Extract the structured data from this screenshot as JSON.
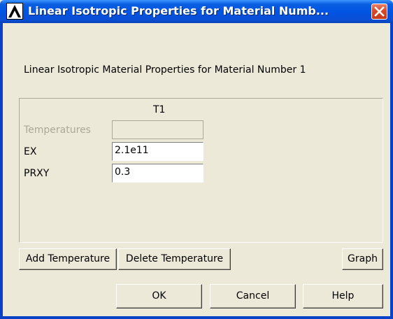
{
  "window": {
    "title": "Linear Isotropic Properties for Material Numb...",
    "app_icon": "ansys-logo-icon",
    "close_icon": "close-icon"
  },
  "dialog": {
    "header": "Linear Isotropic Material Properties for Material Number 1",
    "column_header": "T1",
    "rows": [
      {
        "label": "Temperatures",
        "value": "",
        "enabled": false
      },
      {
        "label": "EX",
        "value": "2.1e11",
        "enabled": true
      },
      {
        "label": "PRXY",
        "value": "0.3",
        "enabled": true
      }
    ]
  },
  "buttons": {
    "add_temperature": "Add Temperature",
    "delete_temperature": "Delete Temperature",
    "graph": "Graph",
    "ok": "OK",
    "cancel": "Cancel",
    "help": "Help"
  },
  "colors": {
    "titlebar": "#0054e3",
    "close_button": "#d8492a",
    "dialog_bg": "#ece9d8",
    "disabled_text": "#aca899"
  }
}
